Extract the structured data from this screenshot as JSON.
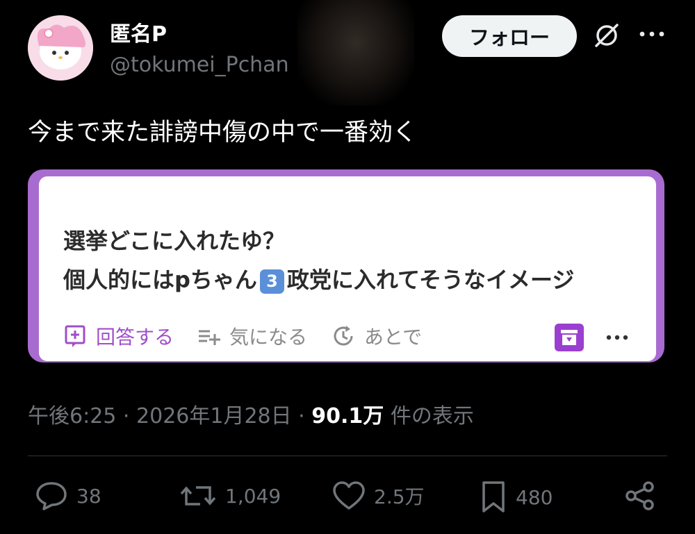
{
  "header": {
    "display_name": "匿名P",
    "handle": "@tokumei_Pchan",
    "follow_label": "フォロー"
  },
  "tweet": {
    "text": "今まで来た誹謗中傷の中で一番効く"
  },
  "card": {
    "question_line1": "選挙どこに入れたゆ？",
    "question_line2_prefix": "個人的にはpちゃん",
    "question_number": "3",
    "question_line2_suffix": "政党に入れてそうなイメージ",
    "answer_label": "回答する",
    "interest_label": "気になる",
    "later_label": "あとで",
    "colors": {
      "accent": "#a14ec9",
      "border": "#a86cd0"
    }
  },
  "meta": {
    "time": "午後6:25",
    "sep1": "·",
    "date": "2026年1月28日",
    "sep2": "·",
    "views": "90.1万",
    "views_suffix": "件の表示"
  },
  "stats": {
    "replies": "38",
    "retweets": "1,049",
    "likes": "2.5万",
    "bookmarks": "480"
  },
  "icons": [
    "avatar",
    "grok-icon",
    "more-icon",
    "add-answer-icon",
    "add-list-icon",
    "later-icon",
    "archive-icon",
    "card-more-icon",
    "reply-icon",
    "retweet-icon",
    "like-icon",
    "bookmark-icon",
    "share-icon"
  ]
}
